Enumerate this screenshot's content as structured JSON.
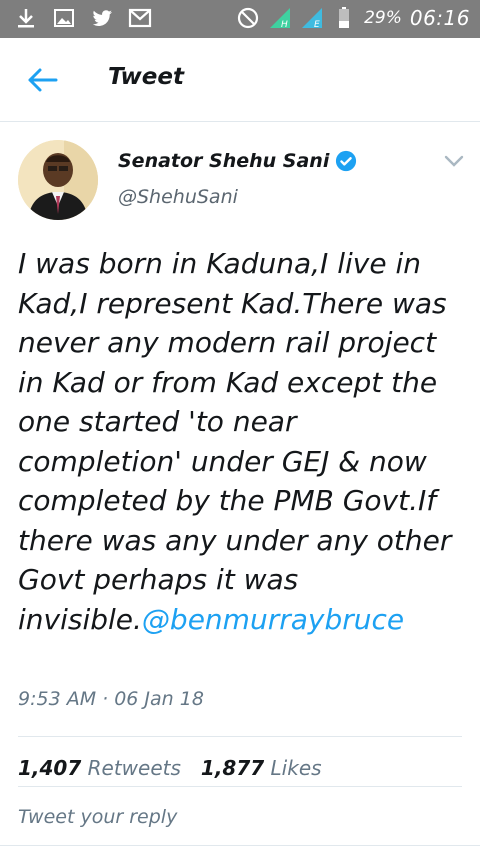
{
  "statusbar": {
    "battery_pct": "29%",
    "time": "06:16",
    "icons": [
      "download-icon",
      "image-icon",
      "twitter-icon",
      "gmail-icon",
      "do-not-disturb-icon",
      "signal-icon",
      "signal-icon",
      "battery-icon"
    ]
  },
  "header": {
    "title": "Tweet"
  },
  "author": {
    "name": "Senator Shehu Sani",
    "handle": "@ShehuSani"
  },
  "tweet": {
    "text": "I was born in Kaduna,I live in Kad,I represent Kad.There was never any modern rail project in Kad or from Kad except the one started 'to near completion' under GEJ & now completed by the PMB Govt.If there was any under any other Govt perhaps it was invisible.",
    "mention": "@benmurraybruce",
    "timestamp": "9:53 AM · 06 Jan 18"
  },
  "stats": {
    "retweets_count": "1,407",
    "retweets_label": "Retweets",
    "likes_count": "1,877",
    "likes_label": "Likes"
  },
  "reply": {
    "placeholder": "Tweet your reply"
  },
  "colors": {
    "accent": "#1da1f2",
    "statusbar": "#7e7e7e",
    "text": "#14171a",
    "muted": "#657786"
  }
}
